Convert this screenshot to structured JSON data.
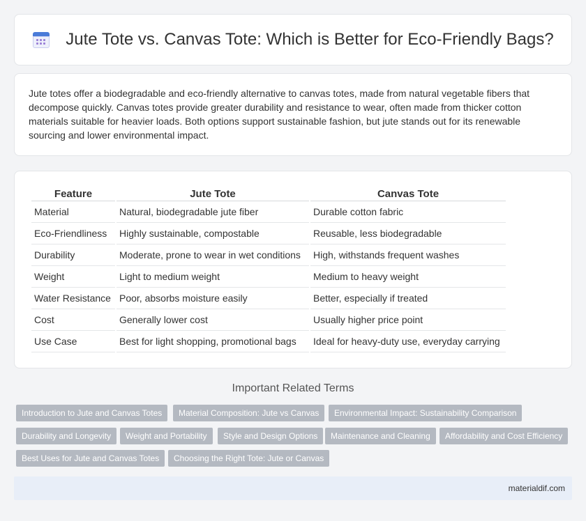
{
  "header": {
    "icon": "calendar-icon",
    "title": "Jute Tote vs. Canvas Tote: Which is Better for Eco-Friendly Bags?"
  },
  "intro": {
    "text": "Jute totes offer a biodegradable and eco-friendly alternative to canvas totes, made from natural vegetable fibers that decompose quickly. Canvas totes provide greater durability and resistance to wear, often made from thicker cotton materials suitable for heavier loads. Both options support sustainable fashion, but jute stands out for its renewable sourcing and lower environmental impact."
  },
  "table": {
    "headers": [
      "Feature",
      "Jute Tote",
      "Canvas Tote"
    ],
    "rows": [
      [
        "Material",
        "Natural, biodegradable jute fiber",
        "Durable cotton fabric"
      ],
      [
        "Eco-Friendliness",
        "Highly sustainable, compostable",
        "Reusable, less biodegradable"
      ],
      [
        "Durability",
        "Moderate, prone to wear in wet conditions",
        "High, withstands frequent washes"
      ],
      [
        "Weight",
        "Light to medium weight",
        "Medium to heavy weight"
      ],
      [
        "Water Resistance",
        "Poor, absorbs moisture easily",
        "Better, especially if treated"
      ],
      [
        "Cost",
        "Generally lower cost",
        "Usually higher price point"
      ],
      [
        "Use Case",
        "Best for light shopping, promotional bags",
        "Ideal for heavy-duty use, everyday carrying"
      ]
    ]
  },
  "related": {
    "title": "Important Related Terms",
    "tags": [
      "Introduction to Jute and Canvas Totes",
      "Material Composition: Jute vs Canvas",
      "Environmental Impact: Sustainability Comparison",
      "Durability and Longevity",
      "Weight and Portability",
      "Style and Design Options",
      "Maintenance and Cleaning",
      "Affordability and Cost Efficiency",
      "Best Uses for Jute and Canvas Totes",
      "Choosing the Right Tote: Jute or Canvas"
    ]
  },
  "footer": {
    "site": "materialdif.com"
  }
}
